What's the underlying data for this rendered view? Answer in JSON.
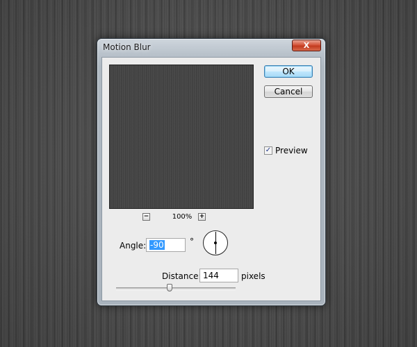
{
  "window": {
    "title": "Motion Blur",
    "close_label": "X"
  },
  "buttons": {
    "ok_label": "OK",
    "cancel_label": "Cancel"
  },
  "preview": {
    "checkbox_label": "Preview",
    "checked": true,
    "check_glyph": "✓"
  },
  "zoom": {
    "minus_label": "−",
    "plus_label": "+",
    "level": "100%"
  },
  "angle": {
    "label": "Angle:",
    "value": "-90",
    "unit": "°"
  },
  "distance": {
    "label": "Distance:",
    "value": "144",
    "unit": "pixels",
    "slider_fraction": 0.45
  },
  "colors": {
    "accent_button": "#3c7fb1",
    "close_button": "#c23a1f",
    "selection": "#3399ff"
  }
}
